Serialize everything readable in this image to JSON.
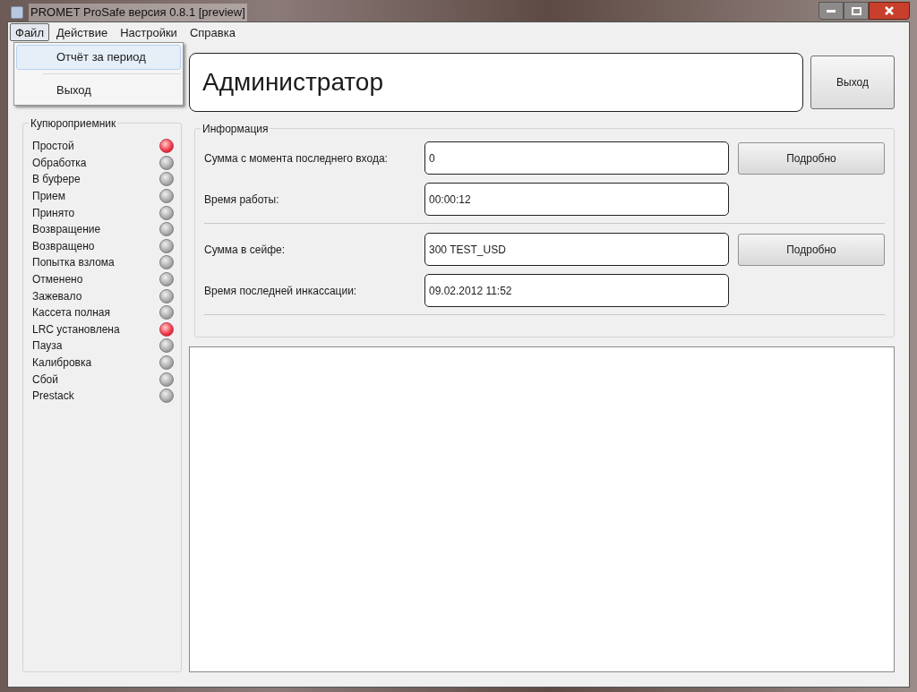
{
  "window": {
    "title": "PROMET ProSafe версия 0.8.1 [preview]"
  },
  "menu": [
    {
      "label": "Файл",
      "selected": true
    },
    {
      "label": "Действие",
      "selected": false
    },
    {
      "label": "Настройки",
      "selected": false
    },
    {
      "label": "Справка",
      "selected": false
    }
  ],
  "dropdown": [
    {
      "label": "Отчёт за период",
      "selected": true
    },
    {
      "label": "Выход",
      "selected": false
    }
  ],
  "user": {
    "name": "Администратор",
    "button": "Выход"
  },
  "indicators": {
    "title": "Купюроприемник",
    "items": [
      {
        "label": "Простой",
        "on": true
      },
      {
        "label": "Обработка",
        "on": false
      },
      {
        "label": "В буфере",
        "on": false
      },
      {
        "label": "Прием",
        "on": false
      },
      {
        "label": "Принято",
        "on": false
      },
      {
        "label": "Возвращение",
        "on": false
      },
      {
        "label": "Возвращено",
        "on": false
      },
      {
        "label": "Попытка взлома",
        "on": false
      },
      {
        "label": "Отменено",
        "on": false
      },
      {
        "label": "Зажевало",
        "on": false
      },
      {
        "label": "Кассета полная",
        "on": false
      },
      {
        "label": "LRC установлена",
        "on": true
      },
      {
        "label": "Пауза",
        "on": false
      },
      {
        "label": "Калибровка",
        "on": false
      },
      {
        "label": "Сбой",
        "on": false
      },
      {
        "label": "Prestack",
        "on": false
      }
    ]
  },
  "info": {
    "title": "Информация",
    "sections": [
      {
        "rows": [
          {
            "label": "Сумма с момента последнего входа:",
            "value": "0",
            "button": "Подробно"
          },
          {
            "label": "Время работы:",
            "value": "00:00:12"
          }
        ]
      },
      {
        "rows": [
          {
            "label": "Сумма в сейфе:",
            "value": "300 TEST_USD",
            "button": "Подробно"
          },
          {
            "label": "Время последней инкассации:",
            "value": "09.02.2012 11:52"
          }
        ]
      }
    ]
  }
}
